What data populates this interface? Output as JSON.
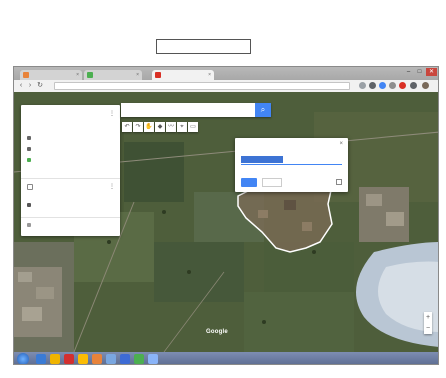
{
  "document": {
    "line1_left": "",
    "line1_mid": "",
    "line1_right": "",
    "line2_left": "",
    "line2_mid": "",
    "box_label": ""
  },
  "browser": {
    "tabs": [
      {
        "label": "",
        "icon_color": "#e8833a"
      },
      {
        "label": "",
        "icon_color": "#4caf50"
      },
      {
        "label": "",
        "icon_color": "#d93025",
        "active": true
      }
    ],
    "url": "",
    "window_controls": [
      "–",
      "□",
      "✕"
    ]
  },
  "map_panel": {
    "title": "",
    "subtitle": "",
    "row1": "",
    "row2": "",
    "row3": "",
    "layer_label": "",
    "layer_link": "",
    "layer_item": "",
    "footer": ""
  },
  "search": {
    "placeholder": ""
  },
  "tools": [
    "↶",
    "↷",
    "✋",
    "◆",
    "〰",
    "⌖",
    "▭"
  ],
  "info_window": {
    "title": "",
    "save_label": "",
    "cancel_label": ""
  },
  "map": {
    "logo": "Google",
    "attribution": "",
    "zoom_in": "+",
    "zoom_out": "−"
  },
  "taskbar": {
    "icons": [
      "#3a7bd5",
      "#f0b400",
      "#d32f2f",
      "#fbbc05",
      "#e8833a",
      "#7aa7e0",
      "#3d6bd4",
      "#4caf50",
      "#8ab4f8"
    ],
    "clock_time": "",
    "clock_date": ""
  },
  "colors": {
    "accent_blue": "#4285f4",
    "polygon_outline": "#ffffff",
    "river": "#b9c6d4"
  }
}
